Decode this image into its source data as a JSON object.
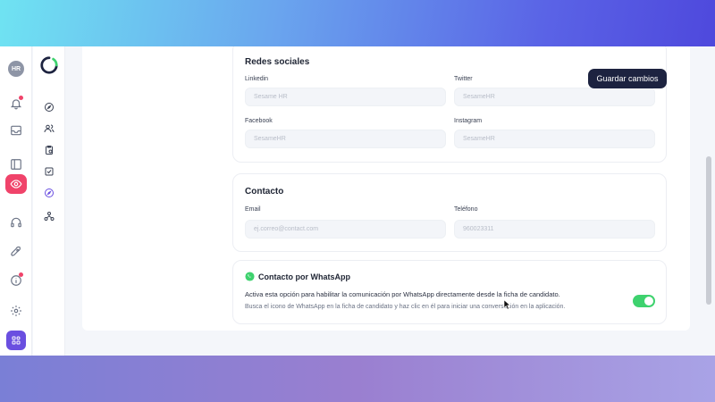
{
  "rail": {
    "avatar_initials": "HR",
    "icons": [
      "bell-icon",
      "inbox-icon",
      "layout-icon",
      "eye-icon",
      "headset-icon",
      "rocket-icon",
      "info-icon",
      "gear-icon",
      "apps-icon"
    ]
  },
  "sidebar": {
    "icons": [
      "compass-icon",
      "users-icon",
      "clipboard-icon",
      "checkbox-icon",
      "explore-icon",
      "hierarchy-icon"
    ]
  },
  "header": {
    "save_label": "Guardar cambios"
  },
  "social": {
    "title": "Redes sociales",
    "linkedin": {
      "label": "Linkedin",
      "placeholder": "Sesame HR"
    },
    "twitter": {
      "label": "Twitter",
      "placeholder": "SesameHR"
    },
    "facebook": {
      "label": "Facebook",
      "placeholder": "SesameHR"
    },
    "instagram": {
      "label": "Instagram",
      "placeholder": "SesameHR"
    }
  },
  "contact": {
    "title": "Contacto",
    "email": {
      "label": "Email",
      "placeholder": "ej.correo@contact.com"
    },
    "phone": {
      "label": "Teléfono",
      "placeholder": "960023311"
    }
  },
  "whatsapp": {
    "title": "Contacto por WhatsApp",
    "description": "Activa esta opción para habilitar la comunicación por WhatsApp directamente desde la ficha de candidato.",
    "hint": "Busca el icono de WhatsApp en la ficha de candidato y haz clic en él para iniciar una conversación en la aplicación.",
    "enabled": true
  },
  "colors": {
    "accent": "#f0436a",
    "primary_button": "#1d2340",
    "toggle_on": "#3ed26e",
    "apps": "#6a4fe0"
  }
}
